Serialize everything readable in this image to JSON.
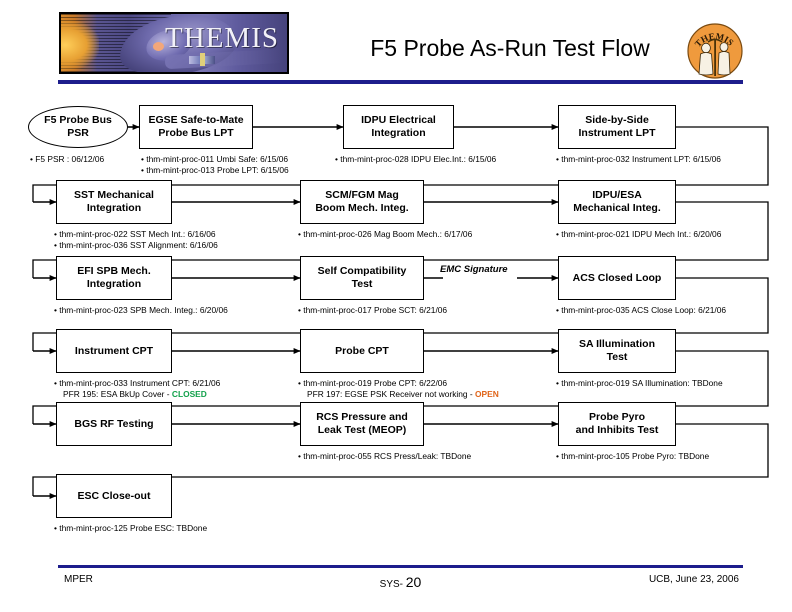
{
  "header": {
    "banner_word": "THEMIS",
    "title": "F5 Probe As-Run Test Flow",
    "seal_word": "THEMIS",
    "rule_color": "#1d1d8c"
  },
  "flow": {
    "start": {
      "label": "F5 Probe Bus\nPSR",
      "shape": "oval"
    },
    "edge_label": "EMC Signature",
    "rows": [
      {
        "nodes": [
          {
            "label": "F5 Probe Bus PSR",
            "shape": "oval",
            "notes": [
              "• F5 PSR : 06/12/06"
            ]
          },
          {
            "label": "EGSE Safe-to-Mate\nProbe Bus LPT",
            "shape": "rect",
            "notes": [
              "• thm-mint-proc-011 Umbi Safe: 6/15/06",
              "• thm-mint-proc-013 Probe LPT: 6/15/06"
            ]
          },
          {
            "label": "IDPU Electrical\nIntegration",
            "shape": "rect",
            "notes": [
              "• thm-mint-proc-028 IDPU Elec.Int.: 6/15/06"
            ]
          },
          {
            "label": "Side-by-Side\nInstrument LPT",
            "shape": "rect",
            "notes": [
              "• thm-mint-proc-032 Instrument LPT: 6/15/06"
            ]
          }
        ]
      },
      {
        "nodes": [
          {
            "label": "SST Mechanical\nIntegration",
            "shape": "rect",
            "notes": [
              "• thm-mint-proc-022 SST Mech Int.: 6/16/06",
              "• thm-mint-proc-036 SST Alignment: 6/16/06"
            ]
          },
          {
            "label": "SCM/FGM Mag\nBoom Mech. Integ.",
            "shape": "rect",
            "notes": [
              "• thm-mint-proc-026 Mag Boom Mech.: 6/17/06"
            ]
          },
          {
            "label": "IDPU/ESA\nMechanical Integ.",
            "shape": "rect",
            "notes": [
              "• thm-mint-proc-021 IDPU Mech Int.: 6/20/06"
            ]
          }
        ]
      },
      {
        "nodes": [
          {
            "label": "EFI SPB Mech.\nIntegration",
            "shape": "rect",
            "notes": [
              "• thm-mint-proc-023 SPB Mech. Integ.: 6/20/06"
            ]
          },
          {
            "label": "Self Compatibility\nTest",
            "shape": "rect",
            "notes": [
              "• thm-mint-proc-017 Probe SCT: 6/21/06"
            ]
          },
          {
            "label": "ACS Closed Loop",
            "shape": "rect",
            "notes": [
              "• thm-mint-proc-035 ACS Close Loop: 6/21/06"
            ]
          }
        ]
      },
      {
        "nodes": [
          {
            "label": "Instrument CPT",
            "shape": "rect",
            "notes": [
              "• thm-mint-proc-033 Instrument CPT: 6/21/06",
              "PFR 195: ESA BkUp Cover -"
            ],
            "note_status": "CLOSED",
            "note_status_color": "#12a14b"
          },
          {
            "label": "Probe CPT",
            "shape": "rect",
            "notes": [
              "• thm-mint-proc-019 Probe CPT: 6/22/06",
              "PFR 197: EGSE PSK Receiver not working -"
            ],
            "note_status": "OPEN",
            "note_status_color": "#e0651a"
          },
          {
            "label": "SA Illumination\nTest",
            "shape": "rect",
            "notes": [
              "• thm-mint-proc-019 SA Illumination: TBDone"
            ]
          }
        ]
      },
      {
        "nodes": [
          {
            "label": "BGS RF Testing",
            "shape": "rect",
            "notes": []
          },
          {
            "label": "RCS Pressure and\nLeak Test (MEOP)",
            "shape": "rect",
            "notes": [
              "• thm-mint-proc-055 RCS Press/Leak: TBDone"
            ]
          },
          {
            "label": "Probe Pyro\nand Inhibits Test",
            "shape": "rect",
            "notes": [
              "• thm-mint-proc-105 Probe Pyro: TBDone"
            ]
          }
        ]
      },
      {
        "nodes": [
          {
            "label": "ESC Close-out",
            "shape": "rect",
            "notes": [
              "• thm-mint-proc-125 Probe ESC: TBDone"
            ]
          }
        ]
      }
    ]
  },
  "footer": {
    "left": "MPER",
    "middle_prefix": "SYS-",
    "page_number": "20",
    "right": "UCB, June 23, 2006"
  }
}
